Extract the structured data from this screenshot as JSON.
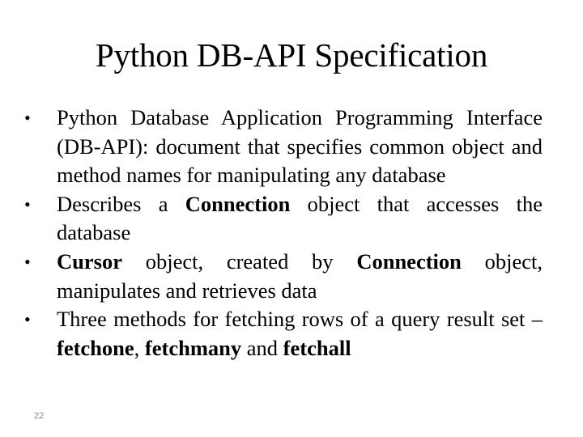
{
  "slide": {
    "title": "Python DB-API Specification",
    "bullets": [
      {
        "segments": [
          {
            "text": "Python Database Application Programming Interface (DB-API): document that specifies common object and method names for manipulating any database",
            "bold": false
          }
        ]
      },
      {
        "segments": [
          {
            "text": "Describes a ",
            "bold": false
          },
          {
            "text": "Connection",
            "bold": true
          },
          {
            "text": " object that accesses the database",
            "bold": false
          }
        ]
      },
      {
        "segments": [
          {
            "text": "Cursor",
            "bold": true
          },
          {
            "text": " object, created by ",
            "bold": false
          },
          {
            "text": "Connection",
            "bold": true
          },
          {
            "text": " object, manipulates and retrieves data",
            "bold": false
          }
        ]
      },
      {
        "segments": [
          {
            "text": "Three methods for fetching rows of a query result set – ",
            "bold": false
          },
          {
            "text": "fetchone",
            "bold": true
          },
          {
            "text": ", ",
            "bold": false
          },
          {
            "text": "fetchmany",
            "bold": true
          },
          {
            "text": " and ",
            "bold": false
          },
          {
            "text": "fetchall",
            "bold": true
          }
        ]
      }
    ],
    "bullet_glyph": "•",
    "page_number": "22"
  }
}
